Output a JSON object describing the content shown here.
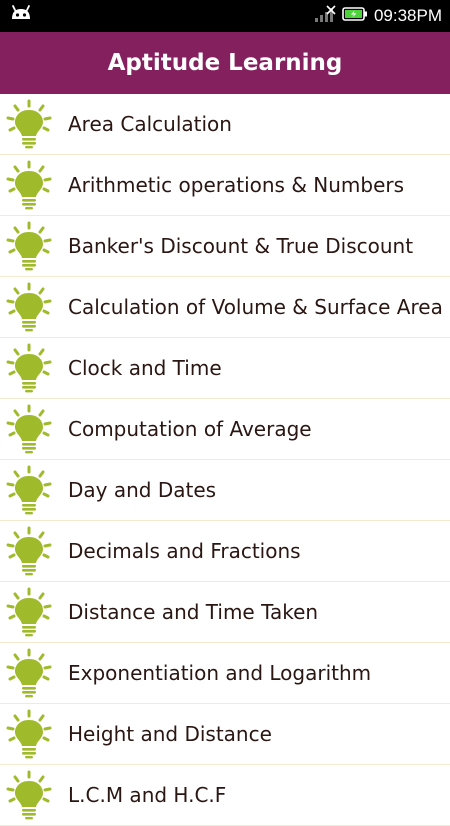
{
  "status_bar": {
    "time": "09:38PM",
    "icons": [
      "android-icon",
      "signal-icon",
      "battery-charging-icon"
    ]
  },
  "app_bar": {
    "title": "Aptitude Learning",
    "color": "#85205f"
  },
  "list": {
    "icon": "lightbulb-icon",
    "icon_color": "#9fba2b",
    "items": [
      {
        "label": "Area Calculation"
      },
      {
        "label": "Arithmetic operations & Numbers"
      },
      {
        "label": "Banker's Discount & True Discount"
      },
      {
        "label": "Calculation of Volume & Surface Area"
      },
      {
        "label": "Clock and Time"
      },
      {
        "label": "Computation of Average"
      },
      {
        "label": "Day and Dates"
      },
      {
        "label": "Decimals and Fractions"
      },
      {
        "label": "Distance and Time Taken"
      },
      {
        "label": "Exponentiation and Logarithm"
      },
      {
        "label": "Height and Distance"
      },
      {
        "label": "L.C.M and H.C.F"
      }
    ]
  }
}
